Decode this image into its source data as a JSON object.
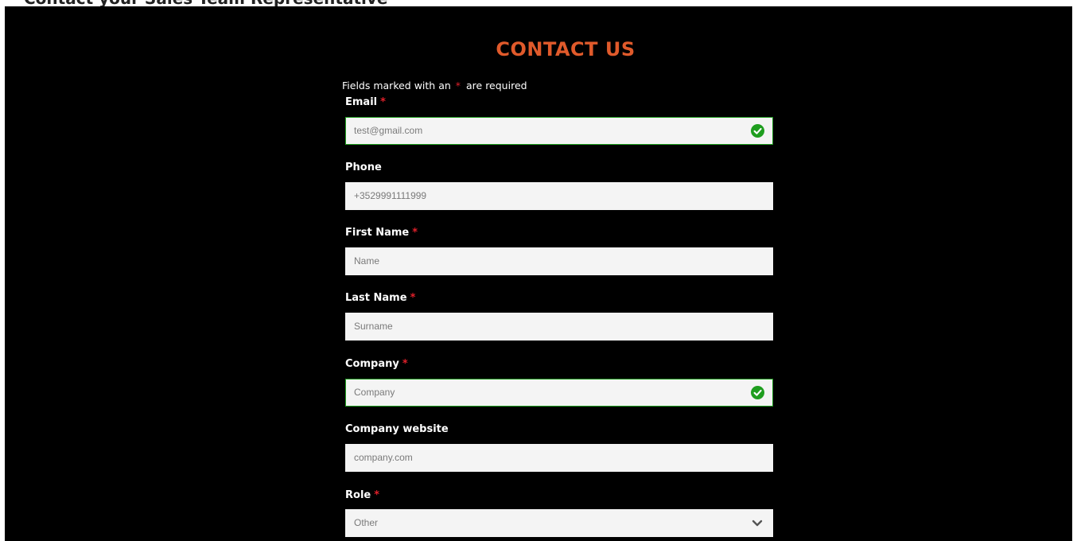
{
  "header_strip": {
    "text": "Contact your Sales Team Representative"
  },
  "page": {
    "title": "CONTACT US",
    "required_note": {
      "before": "Fields marked with an",
      "mark": "*",
      "after": "are required"
    }
  },
  "fields": {
    "email": {
      "label": "Email",
      "required": "*",
      "value": "test@gmail.com",
      "status": "valid"
    },
    "phone": {
      "label": "Phone",
      "placeholder": "+3529991111999"
    },
    "first_name": {
      "label": "First Name",
      "required": "*",
      "placeholder": "Name"
    },
    "last_name": {
      "label": "Last Name",
      "required": "*",
      "placeholder": "Surname"
    },
    "company": {
      "label": "Company",
      "required": "*",
      "value": "Company",
      "status": "valid"
    },
    "company_website": {
      "label": "Company website",
      "placeholder": "company.com"
    },
    "role": {
      "label": "Role",
      "required": "*",
      "selected": "Other"
    }
  },
  "colors": {
    "accent": "#e05a2b",
    "required": "#e0202a",
    "valid": "#1f9e1f",
    "panel_bg": "#000000",
    "input_bg": "#f4f4f4"
  },
  "icons": {
    "valid": "check-circle-icon",
    "dropdown": "chevron-down-icon"
  }
}
